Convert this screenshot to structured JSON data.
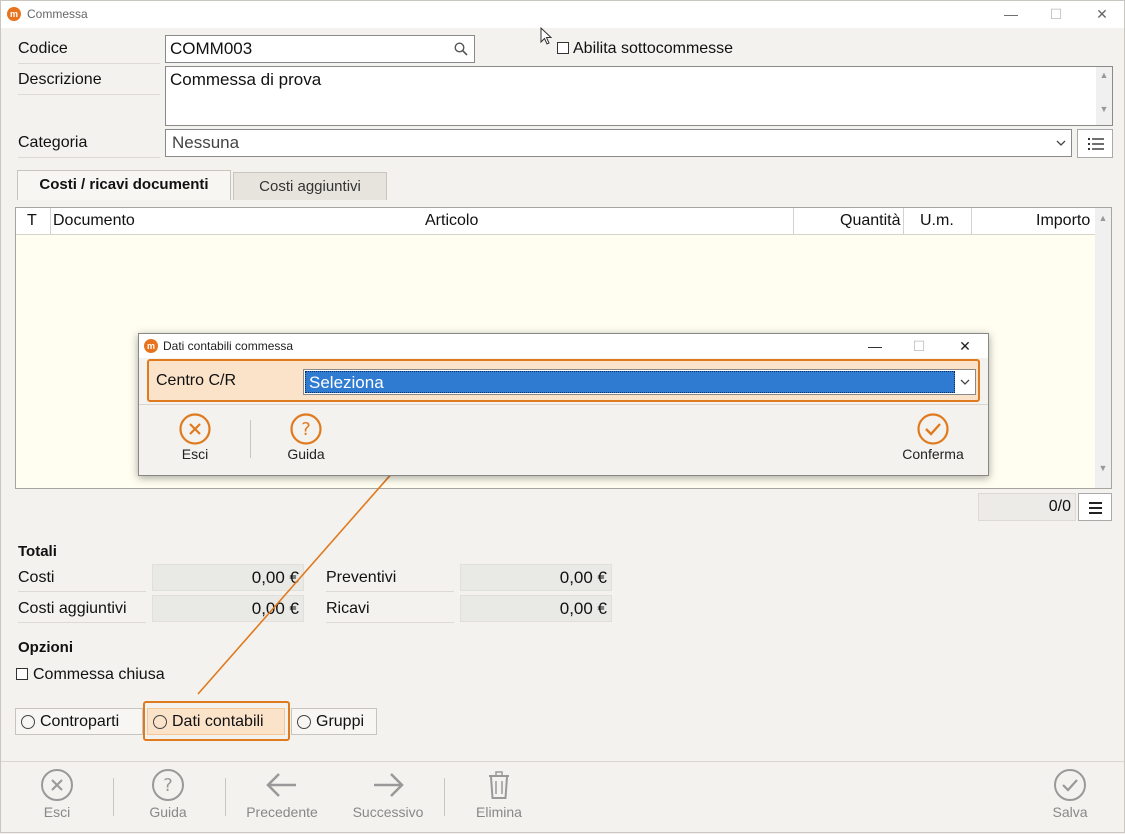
{
  "window": {
    "title": "Commessa"
  },
  "form": {
    "codice_label": "Codice",
    "codice_value": "COMM003",
    "abilita_label": "Abilita sottocommesse",
    "descrizione_label": "Descrizione",
    "descrizione_value": "Commessa di prova",
    "categoria_label": "Categoria",
    "categoria_value": "Nessuna"
  },
  "tabs": [
    {
      "label": "Costi / ricavi documenti"
    },
    {
      "label": "Costi aggiuntivi"
    }
  ],
  "grid": {
    "columns": [
      "T",
      "Documento",
      "Articolo",
      "Quantità",
      "U.m.",
      "Importo"
    ],
    "pager": "0/0"
  },
  "totali": {
    "title": "Totali",
    "costi_label": "Costi",
    "costi_value": "0,00 €",
    "preventivi_label": "Preventivi",
    "preventivi_value": "0,00 €",
    "costi_agg_label": "Costi aggiuntivi",
    "costi_agg_value": "0,00 €",
    "ricavi_label": "Ricavi",
    "ricavi_value": "0,00 €"
  },
  "opzioni": {
    "title": "Opzioni",
    "chiusa_label": "Commessa chiusa"
  },
  "radios": [
    {
      "label": "Controparti"
    },
    {
      "label": "Dati contabili"
    },
    {
      "label": "Gruppi"
    }
  ],
  "toolbar": {
    "esci": "Esci",
    "guida": "Guida",
    "precedente": "Precedente",
    "successivo": "Successivo",
    "elimina": "Elimina",
    "salva": "Salva"
  },
  "dialog": {
    "title": "Dati contabili commessa",
    "centro_label": "Centro C/R",
    "centro_value": "Seleziona",
    "esci": "Esci",
    "guida": "Guida",
    "conferma": "Conferma"
  },
  "colors": {
    "accent": "#e07a1f",
    "selection": "#2e7bd1",
    "grid_bg": "#fffef0"
  }
}
